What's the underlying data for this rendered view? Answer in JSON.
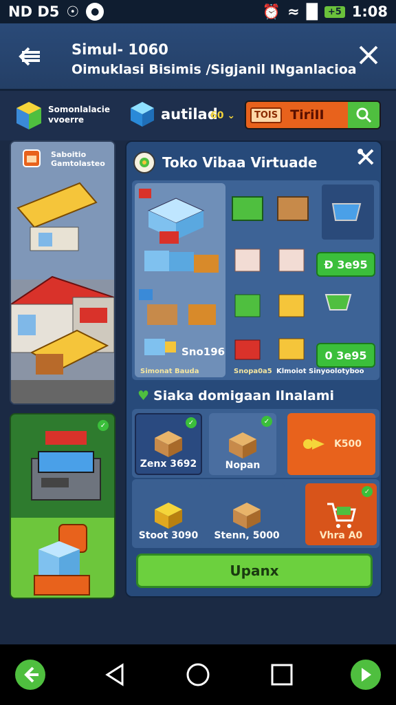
{
  "status": {
    "left_text": "ND D5",
    "time": "1:08",
    "battery": "+5"
  },
  "header": {
    "title": "Simul- 1060",
    "subtitle": "Oimuklasi Bisimis /Sigjanil INganlacioa"
  },
  "info": {
    "company_line1": "Somonlalacie",
    "company_line2": "vvoerre",
    "gem_label": "autilad",
    "gem_count": "60",
    "search_tag": "TOIS",
    "search_value": "TiriII"
  },
  "map": {
    "label_line1": "Saboitio",
    "label_line2": "Gamtolasteo"
  },
  "panel": {
    "title": "Toko Vibaa Virtuade",
    "price_1": "Ð 3e95",
    "price_2": "0 3e95",
    "grid_price": "Sno196",
    "caption_1": "Simonat Bauda",
    "caption_2": "Snopa0a5",
    "caption_3": "Klmoiot Sinyoolotyboo",
    "section_title": "Siaka domigaan Ilnalami",
    "items_row1": [
      {
        "label": "Zenx 3692"
      },
      {
        "label": "Nopan"
      },
      {
        "label": "K500"
      }
    ],
    "items_row2": [
      {
        "label": "Stoot 3090"
      },
      {
        "label": "Stenn, 5000"
      },
      {
        "label": "Vhra A0"
      }
    ],
    "upgrade_label": "Upanx"
  },
  "colors": {
    "accent_green": "#4fbf3f",
    "accent_orange": "#e8621c",
    "panel_blue": "#274a7a"
  }
}
